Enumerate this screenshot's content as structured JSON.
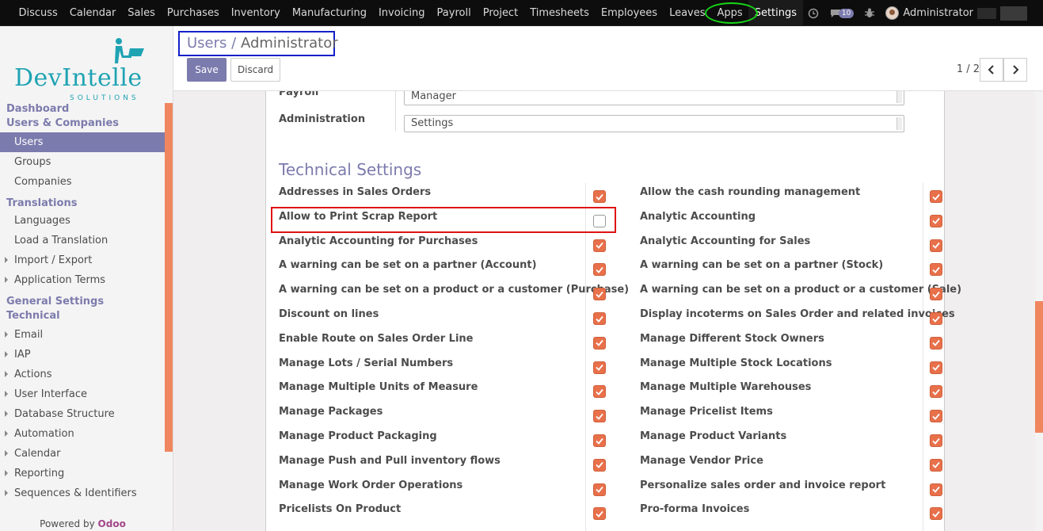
{
  "topbar": {
    "menu": [
      "Discuss",
      "Calendar",
      "Sales",
      "Purchases",
      "Inventory",
      "Manufacturing",
      "Invoicing",
      "Payroll",
      "Project",
      "Timesheets",
      "Employees",
      "Leaves",
      "Apps",
      "Settings"
    ],
    "message_count": "10",
    "user_name": "Administrator"
  },
  "sidebar": {
    "logo": {
      "word": "DevIntelle",
      "sub": "SOLUTIONS"
    },
    "sections": [
      {
        "head": "Dashboard"
      },
      {
        "head": "Users & Companies",
        "items": [
          {
            "label": "Users",
            "active": true
          },
          {
            "label": "Groups"
          },
          {
            "label": "Companies"
          }
        ]
      },
      {
        "head": "Translations",
        "items": [
          {
            "label": "Languages"
          },
          {
            "label": "Load a Translation"
          },
          {
            "label": "Import / Export",
            "caret": true
          },
          {
            "label": "Application Terms",
            "caret": true
          }
        ]
      },
      {
        "head": "General Settings"
      },
      {
        "head": "Technical",
        "items": [
          {
            "label": "Email",
            "caret": true
          },
          {
            "label": "IAP",
            "caret": true
          },
          {
            "label": "Actions",
            "caret": true
          },
          {
            "label": "User Interface",
            "caret": true
          },
          {
            "label": "Database Structure",
            "caret": true
          },
          {
            "label": "Automation",
            "caret": true
          },
          {
            "label": "Calendar",
            "caret": true
          },
          {
            "label": "Reporting",
            "caret": true
          },
          {
            "label": "Sequences & Identifiers",
            "caret": true
          }
        ]
      }
    ],
    "powered_prefix": "Powered by",
    "powered_brand": "Odoo"
  },
  "control_panel": {
    "breadcrumb_parent": "Users",
    "breadcrumb_sep": "/",
    "breadcrumb_current": "Administrator",
    "save_label": "Save",
    "discard_label": "Discard",
    "pager": "1 / 2"
  },
  "form": {
    "fields": [
      {
        "label": "Payroll",
        "value": "Manager"
      },
      {
        "label": "Administration",
        "value": "Settings"
      }
    ],
    "section_title": "Technical Settings",
    "left_settings": [
      {
        "label": "Addresses in Sales Orders",
        "checked": true
      },
      {
        "label": "Allow to Print Scrap Report",
        "checked": false
      },
      {
        "label": "Analytic Accounting for Purchases",
        "checked": true
      },
      {
        "label": "A warning can be set on a partner (Account)",
        "checked": true
      },
      {
        "label": "A warning can be set on a product or a customer (Purchase)",
        "checked": true
      },
      {
        "label": "Discount on lines",
        "checked": true
      },
      {
        "label": "Enable Route on Sales Order Line",
        "checked": true
      },
      {
        "label": "Manage Lots / Serial Numbers",
        "checked": true
      },
      {
        "label": "Manage Multiple Units of Measure",
        "checked": true
      },
      {
        "label": "Manage Packages",
        "checked": true
      },
      {
        "label": "Manage Product Packaging",
        "checked": true
      },
      {
        "label": "Manage Push and Pull inventory flows",
        "checked": true
      },
      {
        "label": "Manage Work Order Operations",
        "checked": true
      },
      {
        "label": "Pricelists On Product",
        "checked": true
      }
    ],
    "right_settings": [
      {
        "label": "Allow the cash rounding management",
        "checked": true
      },
      {
        "label": "Analytic Accounting",
        "checked": true
      },
      {
        "label": "Analytic Accounting for Sales",
        "checked": true
      },
      {
        "label": "A warning can be set on a partner (Stock)",
        "checked": true
      },
      {
        "label": "A warning can be set on a product or a customer (Sale)",
        "checked": true
      },
      {
        "label": "Display incoterms on Sales Order and related invoices",
        "checked": true
      },
      {
        "label": "Manage Different Stock Owners",
        "checked": true
      },
      {
        "label": "Manage Multiple Stock Locations",
        "checked": true
      },
      {
        "label": "Manage Multiple Warehouses",
        "checked": true
      },
      {
        "label": "Manage Pricelist Items",
        "checked": true
      },
      {
        "label": "Manage Product Variants",
        "checked": true
      },
      {
        "label": "Manage Vendor Price",
        "checked": true
      },
      {
        "label": "Personalize sales order and invoice report",
        "checked": true
      },
      {
        "label": "Pro-forma Invoices",
        "checked": true
      }
    ]
  },
  "colors": {
    "brand": "#7c7bad",
    "checkbox": "#e8704a",
    "highlight_red": "#e01212",
    "highlight_blue": "#1420c8",
    "highlight_green": "#17d617"
  }
}
